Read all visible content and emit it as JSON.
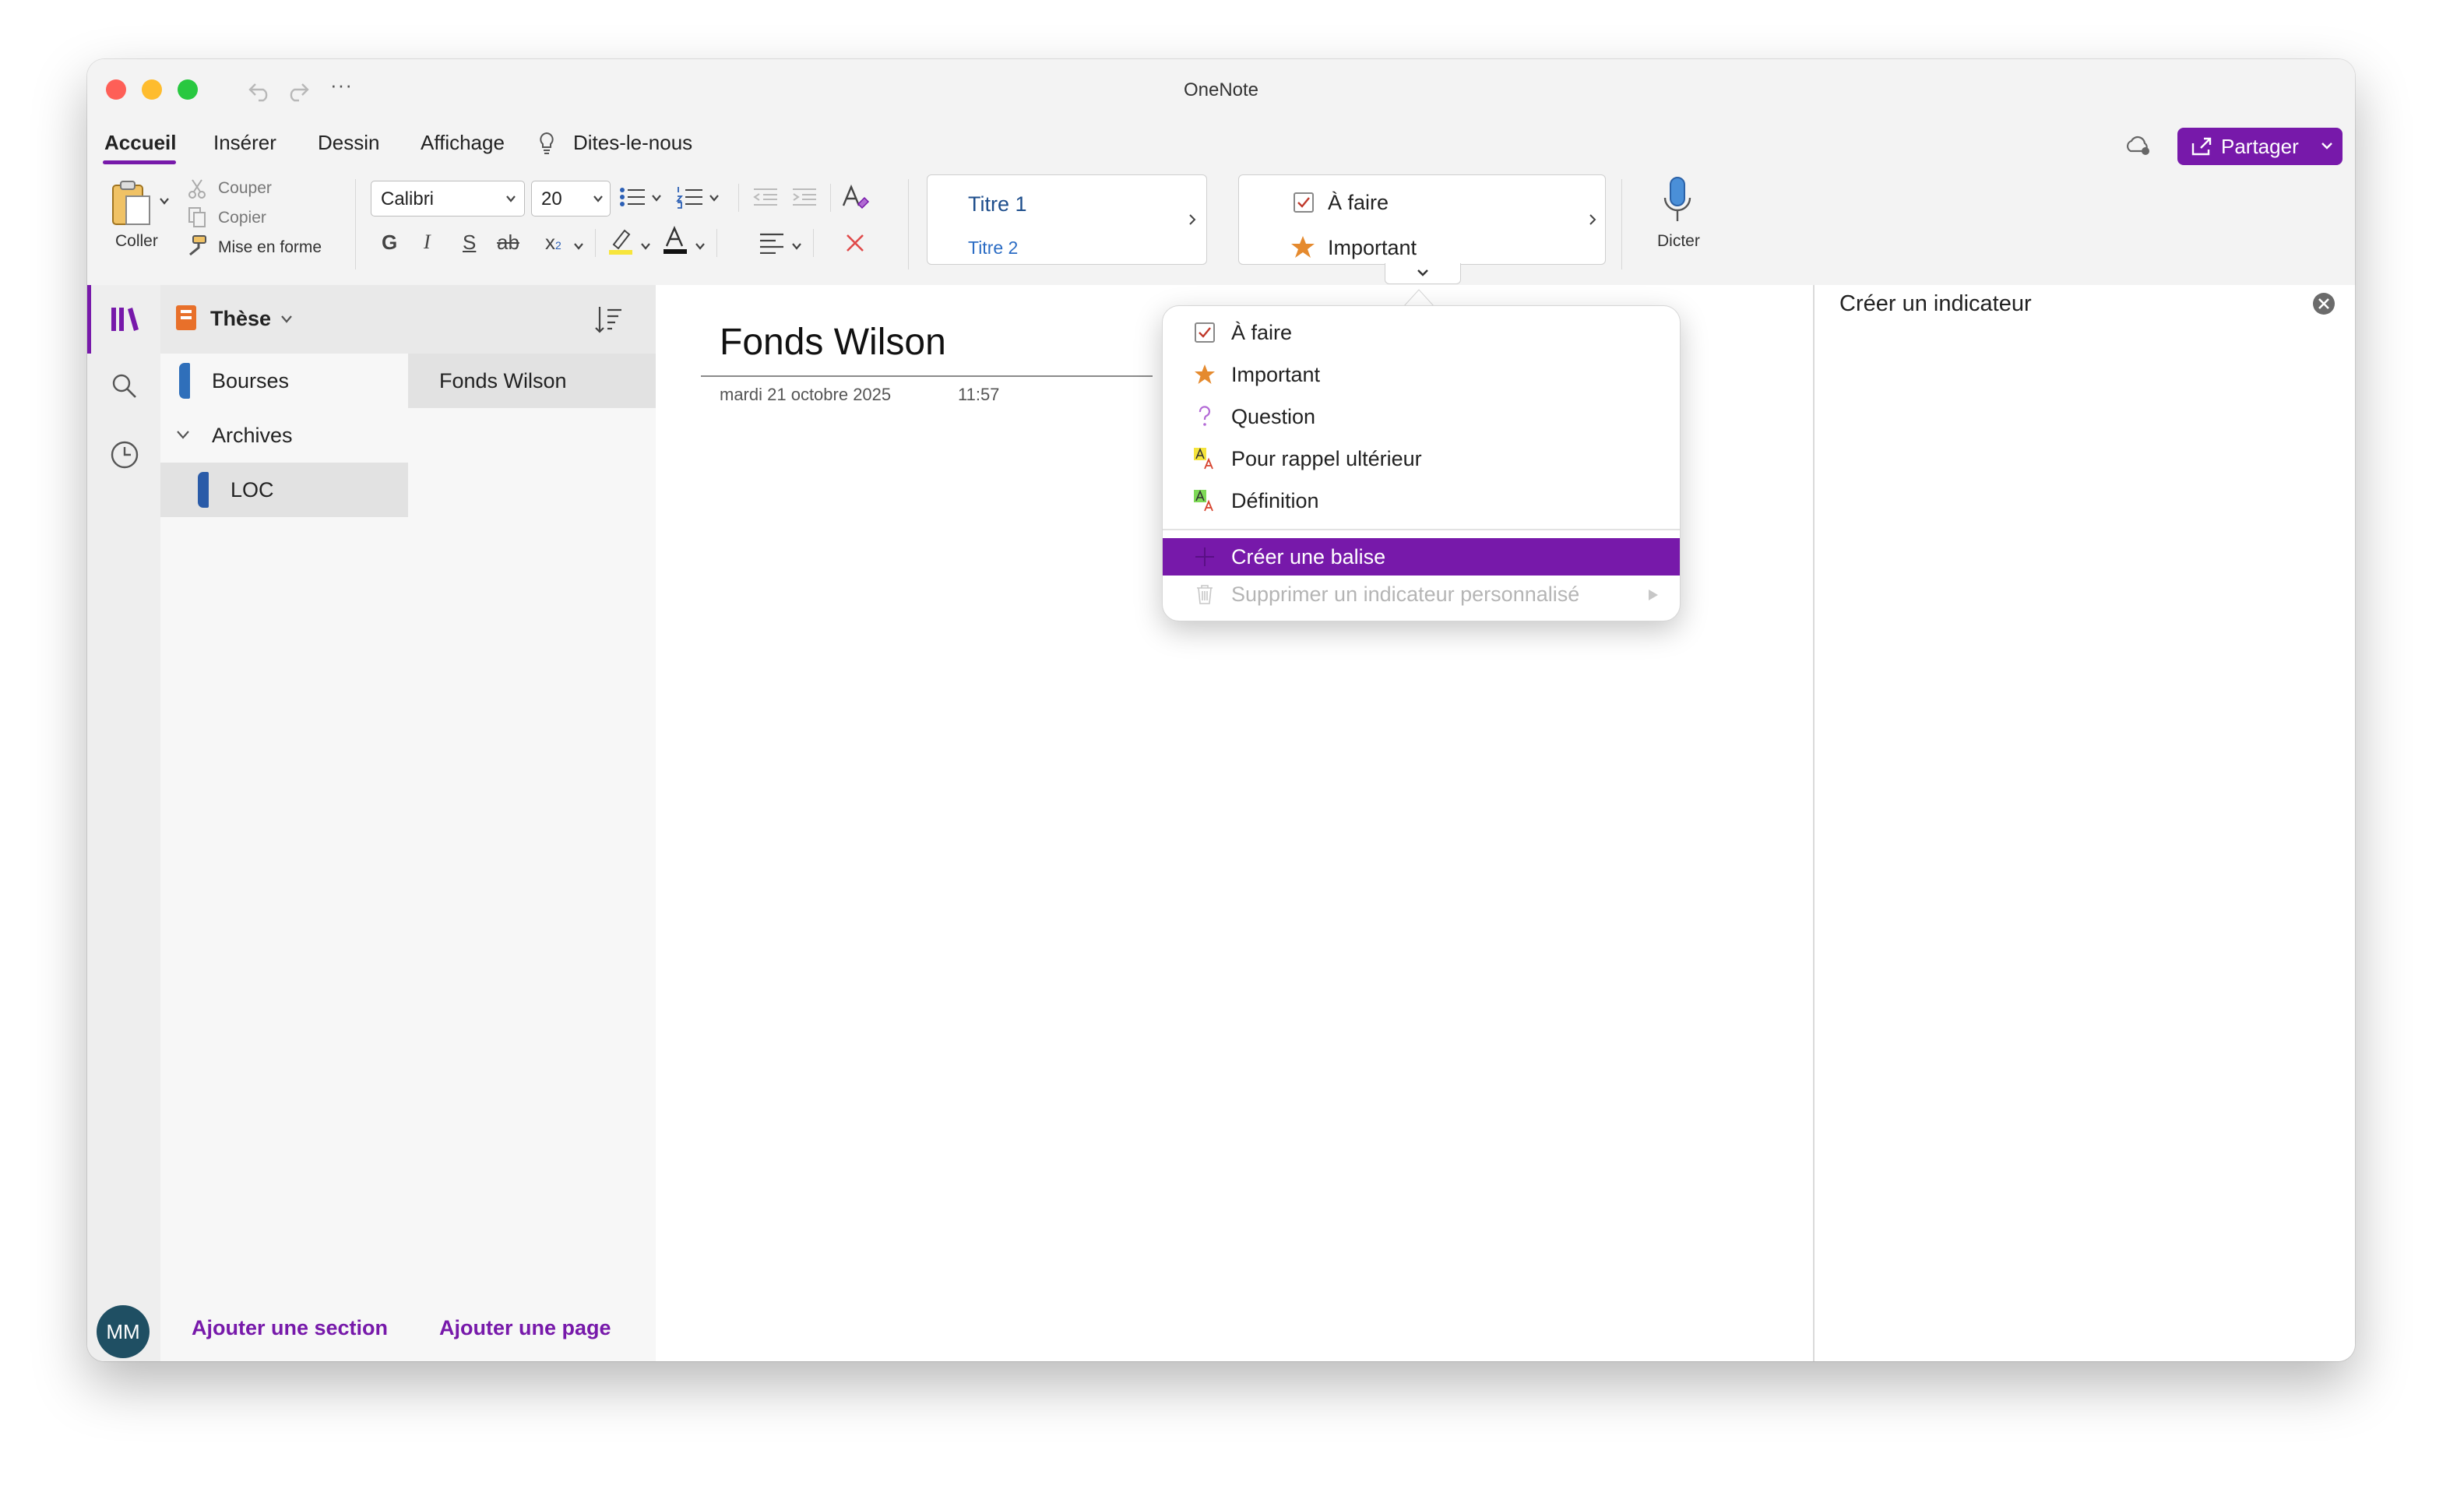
{
  "window": {
    "title": "OneNote"
  },
  "ribbon_tabs": [
    "Accueil",
    "Insérer",
    "Dessin",
    "Affichage",
    "Dites-le-nous"
  ],
  "share_label": "Partager",
  "clipboard": {
    "paste": "Coller",
    "cut": "Couper",
    "copy": "Copier",
    "format_painter": "Mise en forme"
  },
  "font": {
    "name": "Calibri",
    "size": "20"
  },
  "format_buttons": {
    "bold": "G",
    "italic": "I",
    "underline": "S",
    "strike": "ab",
    "subscript": "x"
  },
  "styles": {
    "heading1": "Titre 1",
    "heading2": "Titre 2"
  },
  "tags_gallery": {
    "todo": "À faire",
    "important": "Important"
  },
  "dictate_label": "Dicter",
  "notebook": {
    "name": "Thèse"
  },
  "sections": [
    {
      "label": "Bourses",
      "color": "#2f6fba"
    },
    {
      "label": "Archives",
      "group": true
    },
    {
      "label": "LOC",
      "color": "#2a5ba8"
    }
  ],
  "pages": [
    "Fonds Wilson"
  ],
  "add_section": "Ajouter une section",
  "add_page": "Ajouter une page",
  "avatar": "MM",
  "page": {
    "title": "Fonds Wilson",
    "date": "mardi 21 octobre 2025",
    "time": "11:57"
  },
  "tag_menu": {
    "items": [
      {
        "label": "À faire",
        "icon": "checkbox-icon"
      },
      {
        "label": "Important",
        "icon": "star-icon"
      },
      {
        "label": "Question",
        "icon": "question-icon"
      },
      {
        "label": "Pour rappel ultérieur",
        "icon": "highlight-a-icon"
      },
      {
        "label": "Définition",
        "icon": "highlight-a-icon"
      }
    ],
    "create": "Créer une balise",
    "delete": "Supprimer un indicateur personnalisé"
  },
  "task_pane": {
    "title": "Créer un indicateur"
  },
  "colors": {
    "accent": "#7719aa",
    "heading_blue": "#1e4e8c"
  }
}
